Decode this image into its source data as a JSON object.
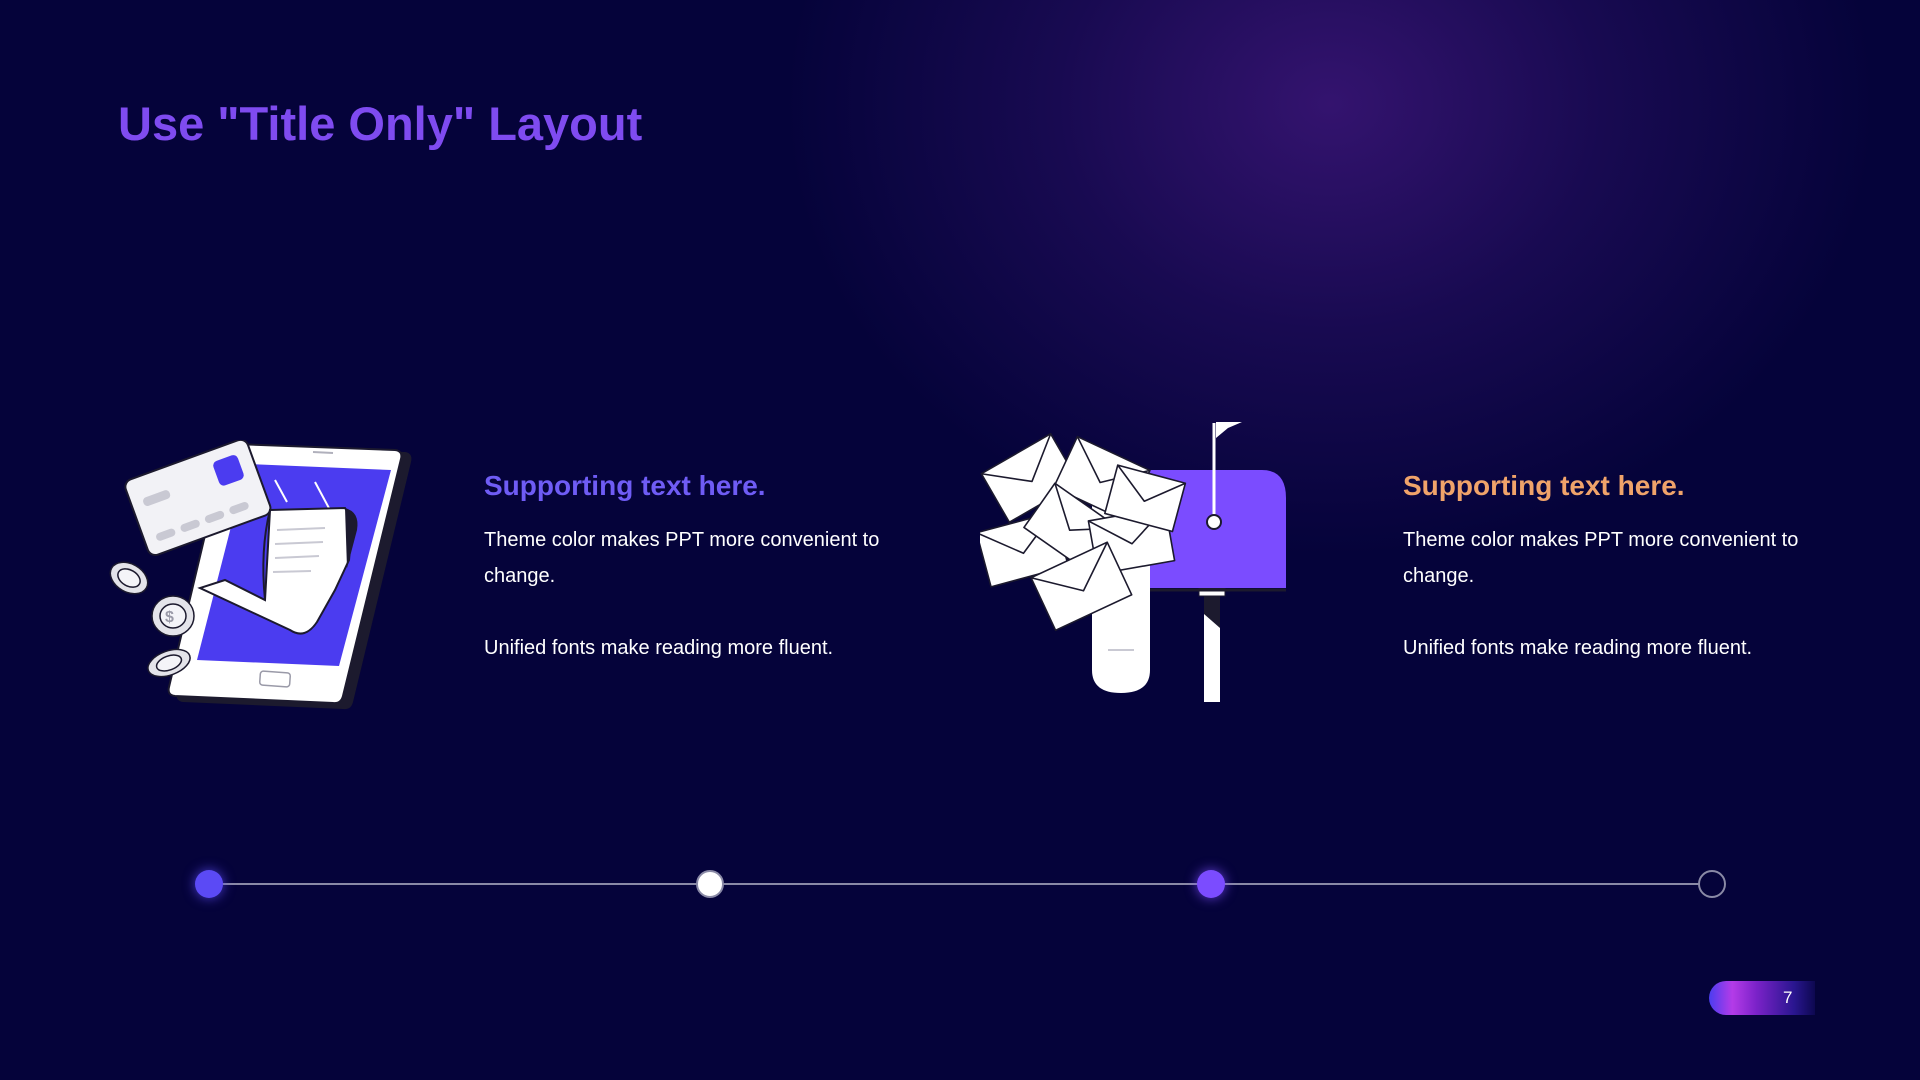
{
  "slide": {
    "title": "Use \"Title Only\" Layout",
    "page_number": "7"
  },
  "items": [
    {
      "heading": "Supporting text here.",
      "heading_color": "#6f5cf5",
      "line1": "Theme color makes PPT more convenient to change.",
      "line2": "Unified fonts make reading more fluent."
    },
    {
      "heading": "Supporting text here.",
      "heading_color": "#f0a36a",
      "line1": "Theme color makes PPT more convenient to change.",
      "line2": "Unified fonts make reading more fluent."
    }
  ],
  "illustrations": {
    "left": "phone-payment-receipt-icon",
    "right": "mailbox-letters-icon"
  },
  "timeline": {
    "dots": [
      "blue-filled",
      "white-filled",
      "purple-filled",
      "outline"
    ]
  },
  "colors": {
    "background": "#05033a",
    "title": "#7f4bf0",
    "accent_blue": "#5b4af5",
    "accent_purple": "#7b4cff",
    "accent_orange": "#f0a36a"
  }
}
